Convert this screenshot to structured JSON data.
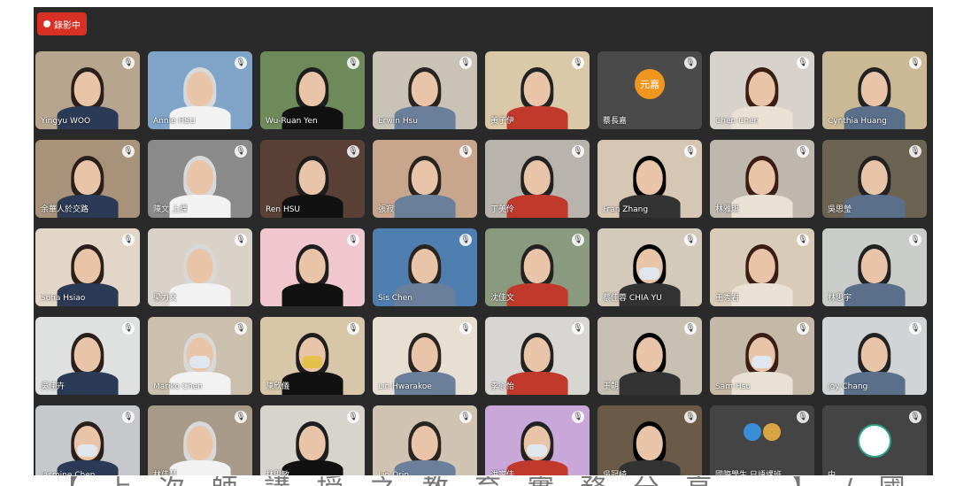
{
  "recording": {
    "label": "錄影中"
  },
  "caption": {
    "text": "【 上 次 師 講 授 之 教 育 實 務 分 享 … 】 / 國 語 課"
  },
  "participants": [
    {
      "name": "Yingyu WOO"
    },
    {
      "name": "Annie HSU"
    },
    {
      "name": "Wu-Ruan Yen"
    },
    {
      "name": "Erwin Hsu"
    },
    {
      "name": "黃子伊"
    },
    {
      "name": "蔡長嘉",
      "avatar_text": "元嘉"
    },
    {
      "name": "Chen Chen"
    },
    {
      "name": "Cynthia Huang"
    },
    {
      "name": "余華人於交路"
    },
    {
      "name": "陳文 上課"
    },
    {
      "name": "Ren HSU"
    },
    {
      "name": "張寂"
    },
    {
      "name": "丁美伶"
    },
    {
      "name": "Fran Zhang"
    },
    {
      "name": "林雅琪"
    },
    {
      "name": "吳思瑩"
    },
    {
      "name": "Sofia Hsiao"
    },
    {
      "name": "梁力文"
    },
    {
      "name": ""
    },
    {
      "name": "Sis Chen"
    },
    {
      "name": "沈佳文"
    },
    {
      "name": "蔡佳蓉 CHIA YU"
    },
    {
      "name": "王秀君"
    },
    {
      "name": "林思宇"
    },
    {
      "name": "吳佳卉"
    },
    {
      "name": "Mariko Chen"
    },
    {
      "name": "陳欣儀"
    },
    {
      "name": "Lin Hwarakoe"
    },
    {
      "name": "李心怡"
    },
    {
      "name": "王朝"
    },
    {
      "name": "Sam Hsu"
    },
    {
      "name": "Joy Chang"
    },
    {
      "name": "Jasmine Chen"
    },
    {
      "name": "林佳慧"
    },
    {
      "name": "林思敏"
    },
    {
      "name": "Lin Orin"
    },
    {
      "name": "洪家佳"
    },
    {
      "name": "吳冠綺"
    },
    {
      "name": "國際學生 日語課班"
    },
    {
      "name": "中"
    }
  ],
  "colors": {
    "tile_bg": "#3c3c3c",
    "meeting_bg": "#2a2a2a",
    "record": "#d93025",
    "avatar": "#f0951e"
  }
}
